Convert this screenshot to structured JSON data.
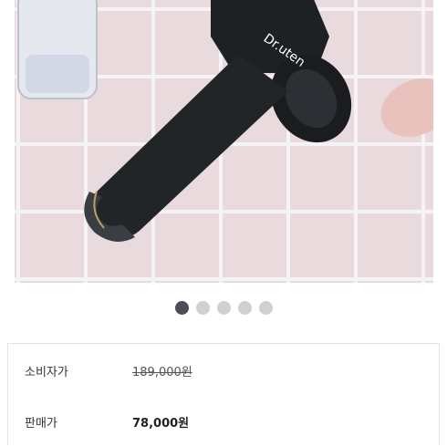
{
  "product_image": {
    "brand_text": "Dr.uten",
    "slide_count": 5,
    "active_slide": 1
  },
  "pricing": {
    "consumer_price_label": "소비자가",
    "consumer_price_value": "189,000원",
    "sale_price_label": "판매가",
    "sale_price_value": "78,000원"
  }
}
